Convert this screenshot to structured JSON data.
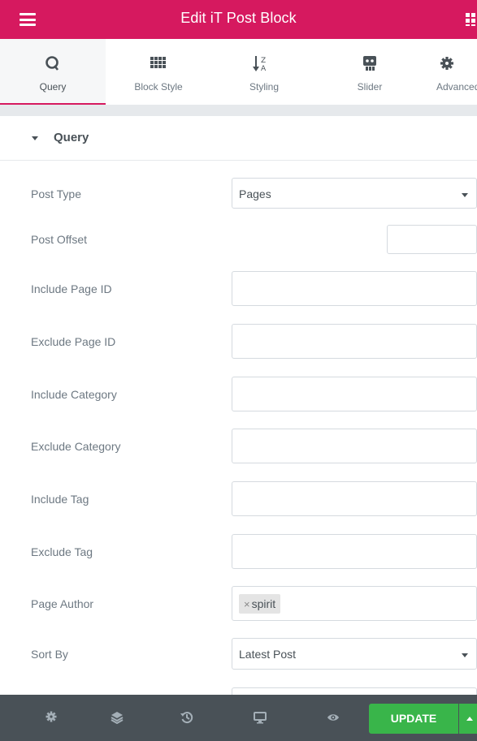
{
  "header": {
    "title": "Edit iT Post Block"
  },
  "tabs": [
    {
      "label": "Query",
      "icon": "search-icon"
    },
    {
      "label": "Block Style",
      "icon": "grid-icon"
    },
    {
      "label": "Styling",
      "icon": "sort-alpha-icon"
    },
    {
      "label": "Slider",
      "icon": "slider-icon"
    },
    {
      "label": "Advanced",
      "icon": "gear-icon"
    }
  ],
  "section": {
    "title": "Query"
  },
  "fields": {
    "post_type": {
      "label": "Post Type",
      "value": "Pages"
    },
    "post_offset": {
      "label": "Post Offset",
      "value": ""
    },
    "include_page_id": {
      "label": "Include Page ID",
      "value": ""
    },
    "exclude_page_id": {
      "label": "Exclude Page ID",
      "value": ""
    },
    "include_category": {
      "label": "Include Category",
      "value": ""
    },
    "exclude_category": {
      "label": "Exclude Category",
      "value": ""
    },
    "include_tag": {
      "label": "Include Tag",
      "value": ""
    },
    "exclude_tag": {
      "label": "Exclude Tag",
      "value": ""
    },
    "page_author": {
      "label": "Page Author",
      "chip_remove": "×",
      "chip": "spirit"
    },
    "sort_by": {
      "label": "Sort By",
      "value": "Latest Post"
    }
  },
  "footer": {
    "update_label": "UPDATE",
    "icons": [
      "gear-icon",
      "layers-icon",
      "history-icon",
      "desktop-icon",
      "eye-icon"
    ]
  },
  "colors": {
    "accent": "#d6195f",
    "footer": "#495157",
    "update": "#39b54a"
  }
}
